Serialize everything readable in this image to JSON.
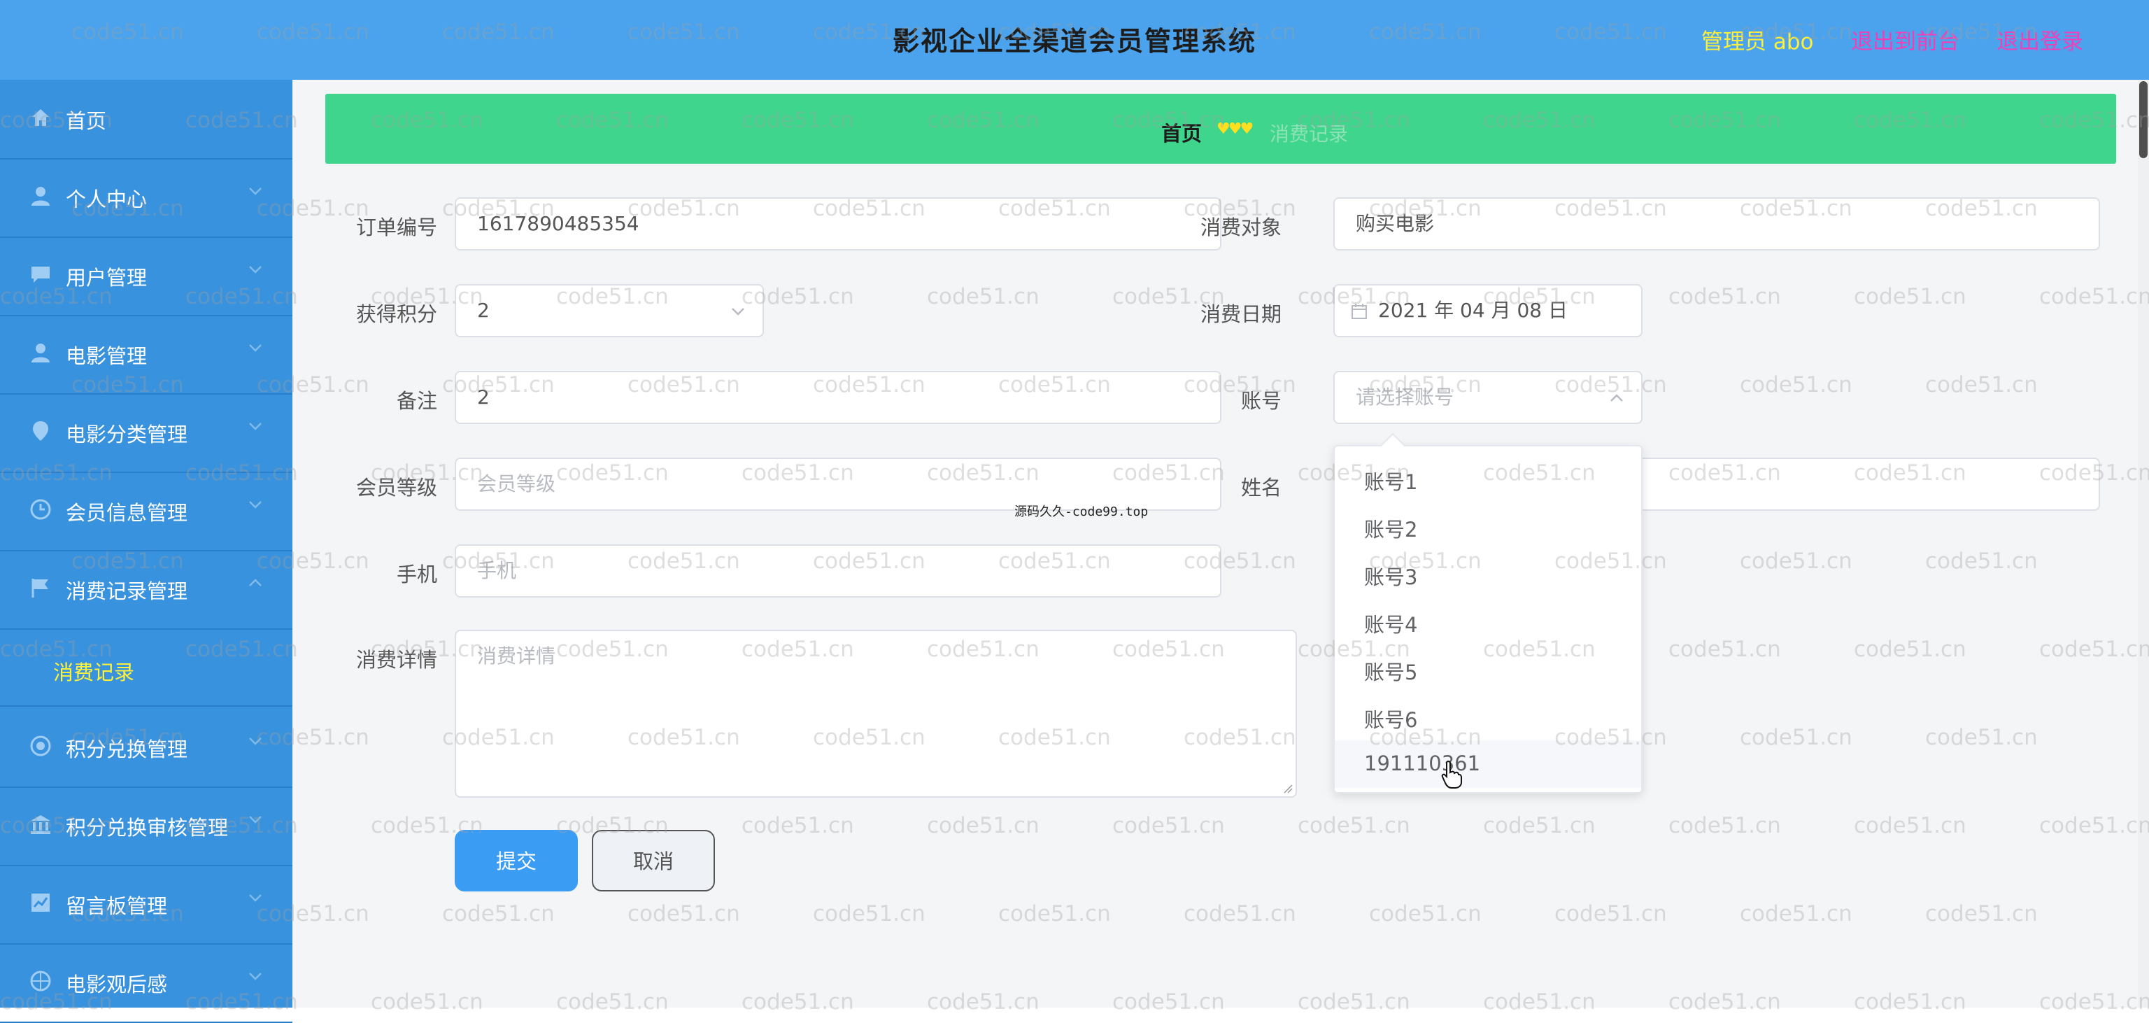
{
  "header": {
    "title": "影视企业全渠道会员管理系统",
    "user": "管理员 abo",
    "back_to_front": "退出到前台",
    "logout": "退出登录"
  },
  "sidebar": {
    "items": [
      {
        "label": "首页",
        "icon": "home-icon"
      },
      {
        "label": "个人中心",
        "icon": "user-icon"
      },
      {
        "label": "用户管理",
        "icon": "chat-icon"
      },
      {
        "label": "电影管理",
        "icon": "user-icon"
      },
      {
        "label": "电影分类管理",
        "icon": "location-icon"
      },
      {
        "label": "会员信息管理",
        "icon": "clock-icon"
      },
      {
        "label": "消费记录管理",
        "icon": "flag-icon"
      },
      {
        "label": "积分兑换管理",
        "icon": "circle-icon"
      },
      {
        "label": "积分兑换审核管理",
        "icon": "bank-icon"
      },
      {
        "label": "留言板管理",
        "icon": "chart-icon"
      },
      {
        "label": "电影观后感",
        "icon": "globe-icon"
      }
    ],
    "sub_active": "消费记录"
  },
  "breadcrumb": {
    "home": "首页",
    "hearts": "♥♥♥",
    "current": "消费记录"
  },
  "form": {
    "order_no_label": "订单编号",
    "order_no_value": "1617890485354",
    "consume_obj_label": "消费对象",
    "consume_obj_value": "购买电影",
    "points_label": "获得积分",
    "points_value": "2",
    "date_label": "消费日期",
    "date_value": "2021 年 04 月 08 日",
    "remark_label": "备注",
    "remark_value": "2",
    "account_label": "账号",
    "account_placeholder": "请选择账号",
    "level_label": "会员等级",
    "level_placeholder": "会员等级",
    "name_label": "姓名",
    "phone_label": "手机",
    "phone_placeholder": "手机",
    "detail_label": "消费详情",
    "detail_placeholder": "消费详情",
    "submit": "提交",
    "cancel": "取消"
  },
  "dropdown": {
    "options": [
      "账号1",
      "账号2",
      "账号3",
      "账号4",
      "账号5",
      "账号6",
      "191110361"
    ],
    "hovered_index": 6
  },
  "overlay_text": "源码久久-code99.top",
  "watermark": "code51.cn",
  "colors": {
    "header": "#4aa3ec",
    "sidebar": "#3992dd",
    "breadcrumb_bar": "#3fd58c",
    "primary_button": "#3b9cf4",
    "active_submenu_text": "#fff23a"
  }
}
